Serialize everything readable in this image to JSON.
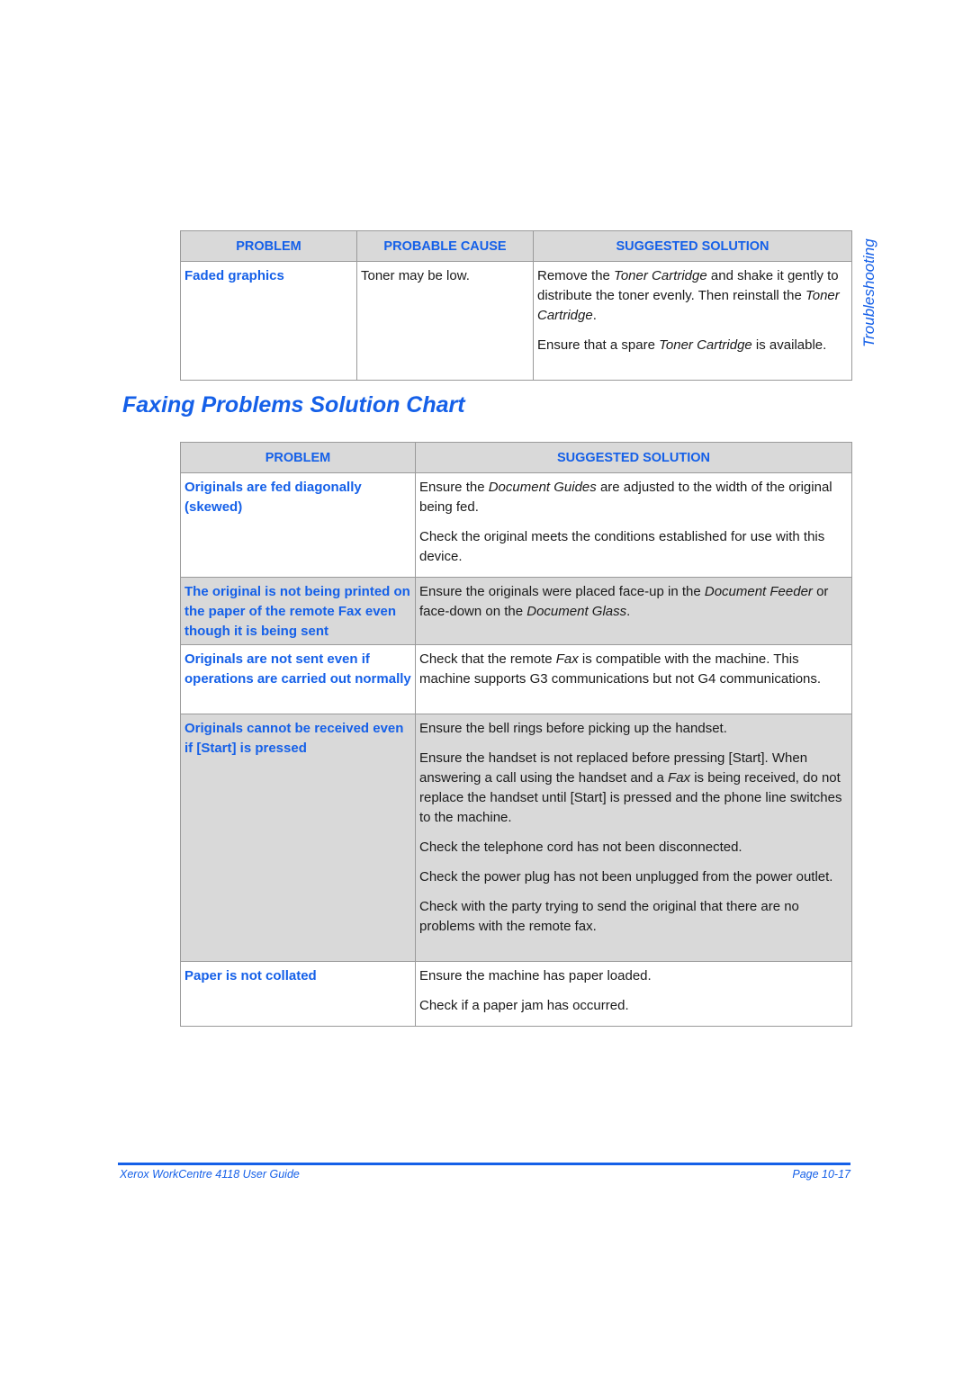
{
  "side_tab": "Troubleshooting",
  "table1": {
    "headers": [
      "PROBLEM",
      "PROBABLE CAUSE",
      "SUGGESTED SOLUTION"
    ],
    "rows": [
      {
        "problem": "Faded graphics",
        "cause": "Toner may be low.",
        "solutions": [
          [
            {
              "t": "Remove the ",
              "i": false
            },
            {
              "t": "Toner Cartridge",
              "i": true
            },
            {
              "t": " and shake it gently to distribute the toner evenly. Then reinstall the ",
              "i": false
            },
            {
              "t": "Toner Cartridge",
              "i": true
            },
            {
              "t": ".",
              "i": false
            }
          ],
          [
            {
              "t": "Ensure that a spare ",
              "i": false
            },
            {
              "t": "Toner Cartridge",
              "i": true
            },
            {
              "t": " is available.",
              "i": false
            }
          ]
        ]
      }
    ]
  },
  "section_title": "Faxing Problems Solution Chart",
  "table2": {
    "headers": [
      "PROBLEM",
      "SUGGESTED SOLUTION"
    ],
    "rows": [
      {
        "problem": "Originals are fed diagonally (skewed)",
        "shaded": false,
        "solutions": [
          [
            {
              "t": "Ensure the ",
              "i": false
            },
            {
              "t": "Document Guides",
              "i": true
            },
            {
              "t": " are adjusted to the width of the original being fed.",
              "i": false
            }
          ],
          [
            {
              "t": "Check the original meets the conditions established for use with this device.",
              "i": false
            }
          ]
        ]
      },
      {
        "problem": "The original is not being printed on the paper of the remote Fax even though it is being sent",
        "shaded": true,
        "solutions": [
          [
            {
              "t": "Ensure the originals were placed face-up in the ",
              "i": false
            },
            {
              "t": "Document Feeder",
              "i": true
            },
            {
              "t": " or face-down on the ",
              "i": false
            },
            {
              "t": "Document Glass",
              "i": true
            },
            {
              "t": ".",
              "i": false
            }
          ]
        ]
      },
      {
        "problem": "Originals are not sent even if operations are carried out normally",
        "shaded": false,
        "solutions": [
          [
            {
              "t": "Check that the remote ",
              "i": false
            },
            {
              "t": "Fax",
              "i": true
            },
            {
              "t": " is compatible with the machine. This machine supports G3 communications but not G4 communications.",
              "i": false
            }
          ]
        ]
      },
      {
        "problem": "Originals cannot be received even if [Start] is pressed",
        "shaded": true,
        "solutions": [
          [
            {
              "t": "Ensure the bell rings before picking up the handset.",
              "i": false
            }
          ],
          [
            {
              "t": "Ensure the handset is not replaced before pressing [Start]. When answering a call using the handset and a ",
              "i": false
            },
            {
              "t": "Fax",
              "i": true
            },
            {
              "t": " is being received, do not replace the handset until [Start] is pressed and the phone line switches to the machine.",
              "i": false
            }
          ],
          [
            {
              "t": "Check the telephone cord has not been disconnected.",
              "i": false
            }
          ],
          [
            {
              "t": "Check the power plug has not been unplugged from the power outlet.",
              "i": false
            }
          ],
          [
            {
              "t": "Check with the party trying to send the original that there are no problems with the remote fax.",
              "i": false
            }
          ]
        ]
      },
      {
        "problem": "Paper is not collated",
        "shaded": false,
        "solutions": [
          [
            {
              "t": "Ensure the machine has paper loaded.",
              "i": false
            }
          ],
          [
            {
              "t": "Check if a paper jam has occurred.",
              "i": false
            }
          ]
        ]
      }
    ]
  },
  "footer": {
    "left": "Xerox WorkCentre 4118 User Guide",
    "right": "Page 10-17"
  },
  "colors": {
    "accent": "#1560e8",
    "header_bg": "#d9d9d9",
    "border": "#9a9a9a"
  }
}
